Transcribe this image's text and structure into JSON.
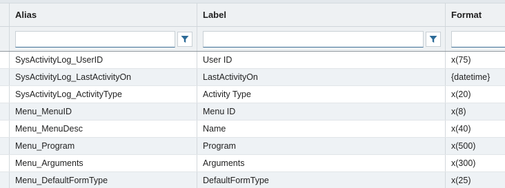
{
  "headers": {
    "alias": "Alias",
    "label": "Label",
    "format": "Format"
  },
  "filter": {
    "alias_value": "",
    "label_value": "",
    "format_value": "",
    "icon": "filter-icon",
    "icon_color": "#2c6a97"
  },
  "rows": [
    {
      "alias": "SysActivityLog_UserID",
      "label": "User ID",
      "format": "x(75)"
    },
    {
      "alias": "SysActivityLog_LastActivityOn",
      "label": "LastActivityOn",
      "format": "{datetime}"
    },
    {
      "alias": "SysActivityLog_ActivityType",
      "label": "Activity Type",
      "format": "x(20)"
    },
    {
      "alias": "Menu_MenuID",
      "label": "Menu ID",
      "format": "x(8)"
    },
    {
      "alias": "Menu_MenuDesc",
      "label": "Name",
      "format": "x(40)"
    },
    {
      "alias": "Menu_Program",
      "label": "Program",
      "format": "x(500)"
    },
    {
      "alias": "Menu_Arguments",
      "label": "Arguments",
      "format": "x(300)"
    },
    {
      "alias": "Menu_DefaultFormType",
      "label": "DefaultFormType",
      "format": "x(25)"
    }
  ]
}
